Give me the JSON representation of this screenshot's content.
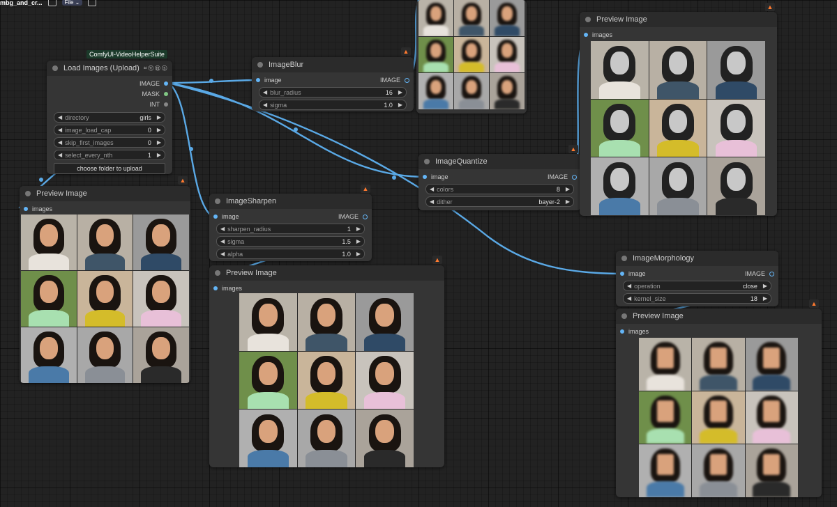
{
  "topbar": {
    "workflow_name": "mbg_and_cr...",
    "file_label": "File"
  },
  "colors": {
    "wire": "#5aa9e6",
    "image_slot": "#64b5f6",
    "mask_slot": "#81c784",
    "node_bg": "#353535",
    "canvas_bg": "#222222"
  },
  "badges": {
    "video_helper": "ComfyUI-VideoHelperSuite"
  },
  "load_images": {
    "title": "Load Images (Upload)",
    "title_icons": "⌗ Ⓥ Ⓗ Ⓢ",
    "outputs": [
      "IMAGE",
      "MASK",
      "INT"
    ],
    "widgets": [
      {
        "name": "directory",
        "value": "girls"
      },
      {
        "name": "image_load_cap",
        "value": "0"
      },
      {
        "name": "skip_first_images",
        "value": "0"
      },
      {
        "name": "select_every_nth",
        "value": "1"
      }
    ],
    "button": "choose folder to upload"
  },
  "image_blur": {
    "title": "ImageBlur",
    "input": "image",
    "output": "IMAGE",
    "widgets": [
      {
        "name": "blur_radius",
        "value": "16"
      },
      {
        "name": "sigma",
        "value": "1.0"
      }
    ]
  },
  "image_sharpen": {
    "title": "ImageSharpen",
    "input": "image",
    "output": "IMAGE",
    "widgets": [
      {
        "name": "sharpen_radius",
        "value": "1"
      },
      {
        "name": "sigma",
        "value": "1.5"
      },
      {
        "name": "alpha",
        "value": "1.0"
      }
    ]
  },
  "image_quantize": {
    "title": "ImageQuantize",
    "input": "image",
    "output": "IMAGE",
    "widgets": [
      {
        "name": "colors",
        "value": "8"
      },
      {
        "name": "dither",
        "value": "bayer-2"
      }
    ]
  },
  "image_morphology": {
    "title": "ImageMorphology",
    "input": "image",
    "output": "IMAGE",
    "widgets": [
      {
        "name": "operation",
        "value": "close"
      },
      {
        "name": "kernel_size",
        "value": "18"
      }
    ]
  },
  "preview_left": {
    "title": "Preview Image",
    "input": "images"
  },
  "preview_center": {
    "title": "Preview Image",
    "input": "images"
  },
  "preview_top_right": {
    "title": "Preview Image",
    "input": "images"
  },
  "preview_bottom_right": {
    "title": "Preview Image",
    "input": "images"
  },
  "photos": [
    {
      "bg": "#b9b3a8",
      "body": "#e8e3dc"
    },
    {
      "bg": "#b8b0a4",
      "body": "#3f5568"
    },
    {
      "bg": "#9a9a9a",
      "body": "#2f4a66"
    },
    {
      "bg": "#6f8f4a",
      "body": "#a8e0b0"
    },
    {
      "bg": "#c9b59a",
      "body": "#d4bc2a"
    },
    {
      "bg": "#c8c3bc",
      "body": "#e8c0d8"
    },
    {
      "bg": "#b0b0b0",
      "body": "#4a7aa8"
    },
    {
      "bg": "#a8a8a8",
      "body": "#8a8f96"
    },
    {
      "bg": "#aaa39a",
      "body": "#2a2a2a"
    }
  ]
}
